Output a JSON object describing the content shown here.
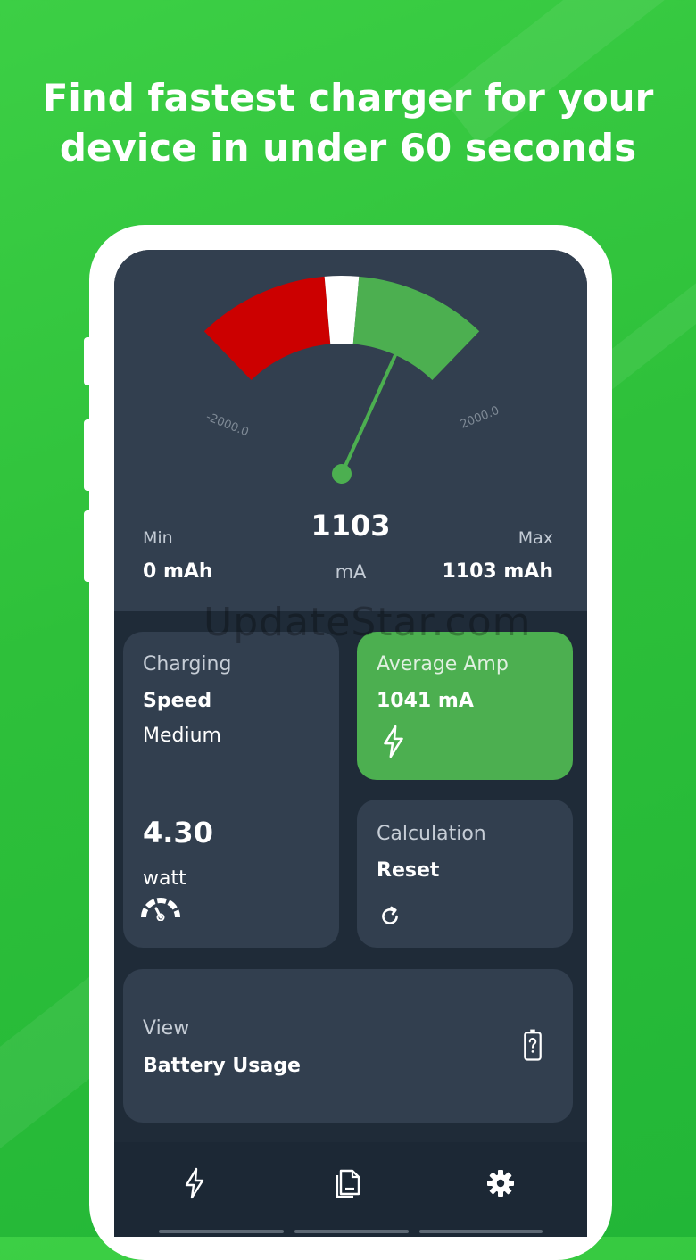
{
  "headline": {
    "line1": "Find fastest charger for your",
    "line2": "device in under 60 seconds"
  },
  "gauge": {
    "min_label": "-2000.0",
    "max_label": "2000.0",
    "scale_min": -2000,
    "scale_max": 2000,
    "needle_value": 1103,
    "colors": {
      "negative": "#cc0000",
      "zero": "#ffffff",
      "positive": "#4caf50"
    }
  },
  "readings": {
    "min_title": "Min",
    "min_value": "0 mAh",
    "current_value": "1103",
    "current_unit": "mA",
    "max_title": "Max",
    "max_value": "1103 mAh"
  },
  "cards": {
    "charging": {
      "title": "Charging",
      "subtitle": "Speed",
      "status": "Medium",
      "power_value": "4.30",
      "power_unit": "watt",
      "icon": "speedometer-icon"
    },
    "average_amp": {
      "title": "Average Amp",
      "value": "1041 mA",
      "icon": "lightning-icon"
    },
    "calculation": {
      "title": "Calculation",
      "action": "Reset",
      "icon": "refresh-icon"
    },
    "battery_usage": {
      "title": "View",
      "subtitle": "Battery Usage",
      "icon": "battery-question-icon"
    }
  },
  "watermark": "UpdateStar.com",
  "nav": {
    "items": [
      "lightning-icon",
      "document-icon",
      "gear-icon"
    ]
  },
  "colors": {
    "background_green": "#2ec03a",
    "panel": "#323f4f",
    "screen": "#1f2b38",
    "accent_green": "#4caf50"
  }
}
